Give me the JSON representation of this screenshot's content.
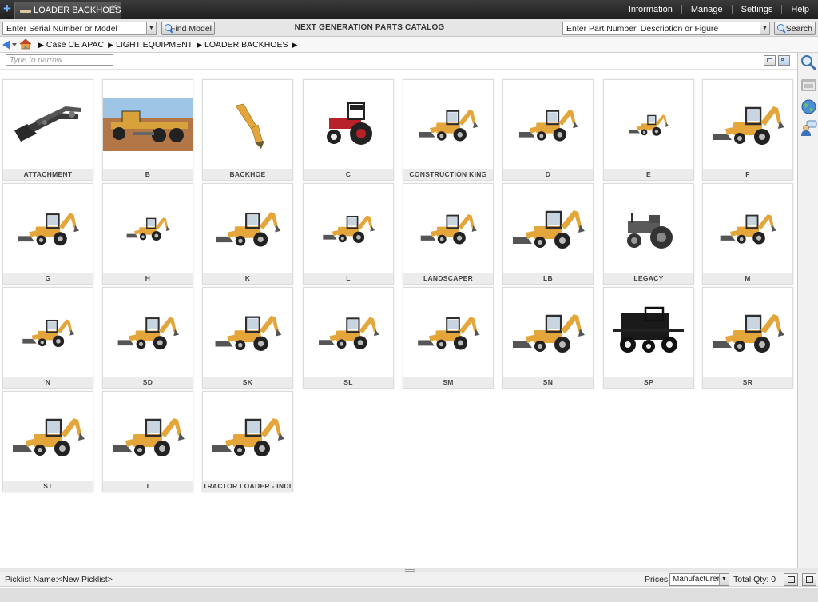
{
  "window": {
    "new_tab_symbol": "+",
    "tab_label": "LOADER BACKHOES",
    "tab_close": "×"
  },
  "top_menu": [
    "Information",
    "Manage",
    "Settings",
    "Help"
  ],
  "search": {
    "serial_placeholder": "Enter Serial Number or Model",
    "find_model_label": "Find Model",
    "catalog_title": "NEXT GENERATION PARTS CATALOG",
    "part_placeholder": "Enter Part Number, Description or Figure",
    "search_label": "Search"
  },
  "breadcrumb": [
    "Case CE APAC",
    "LIGHT EQUIPMENT",
    "LOADER BACKHOES"
  ],
  "breadcrumb_separator": "▶",
  "narrow": {
    "placeholder": "Type to narrow"
  },
  "models": [
    {
      "label": "ATTACHMENT",
      "icon": "loader-attachment-icon"
    },
    {
      "label": "B",
      "icon": "motor-grader-photo"
    },
    {
      "label": "BACKHOE",
      "icon": "backhoe-arm-icon"
    },
    {
      "label": "C",
      "icon": "red-tractor-icon"
    },
    {
      "label": "CONSTRUCTION KING",
      "icon": "backhoe-loader-icon"
    },
    {
      "label": "D",
      "icon": "backhoe-loader-icon"
    },
    {
      "label": "E",
      "icon": "backhoe-loader-icon"
    },
    {
      "label": "F",
      "icon": "backhoe-loader-icon"
    },
    {
      "label": "G",
      "icon": "backhoe-loader-icon"
    },
    {
      "label": "H",
      "icon": "backhoe-loader-icon"
    },
    {
      "label": "K",
      "icon": "backhoe-loader-icon"
    },
    {
      "label": "L",
      "icon": "backhoe-loader-icon"
    },
    {
      "label": "LANDSCAPER",
      "icon": "backhoe-loader-icon"
    },
    {
      "label": "LB",
      "icon": "backhoe-loader-icon"
    },
    {
      "label": "LEGACY",
      "icon": "gray-tractor-icon"
    },
    {
      "label": "M",
      "icon": "backhoe-loader-icon"
    },
    {
      "label": "N",
      "icon": "backhoe-loader-icon"
    },
    {
      "label": "SD",
      "icon": "backhoe-loader-icon"
    },
    {
      "label": "SK",
      "icon": "backhoe-loader-icon"
    },
    {
      "label": "SL",
      "icon": "backhoe-loader-icon"
    },
    {
      "label": "SM",
      "icon": "backhoe-loader-icon"
    },
    {
      "label": "SN",
      "icon": "backhoe-loader-icon"
    },
    {
      "label": "SP",
      "icon": "sprayer-icon"
    },
    {
      "label": "SR",
      "icon": "backhoe-loader-icon"
    },
    {
      "label": "ST",
      "icon": "backhoe-loader-icon"
    },
    {
      "label": "T",
      "icon": "backhoe-loader-icon"
    },
    {
      "label": "TRACTOR LOADER - INDIA",
      "icon": "backhoe-loader-icon"
    }
  ],
  "sidebar": [
    "search-icon",
    "catalog-icon",
    "globe-icon",
    "user-chat-icon"
  ],
  "status": {
    "picklist_label": "Picklist Name:",
    "picklist_value": "<New Picklist>",
    "prices_label": "Prices:",
    "prices_value": "Manufacturer",
    "total_qty": "Total Qty: 0"
  },
  "colors": {
    "case_yellow": "#e4a53a",
    "cab_dark": "#2d2d2d",
    "tractor_red": "#b8202a"
  }
}
